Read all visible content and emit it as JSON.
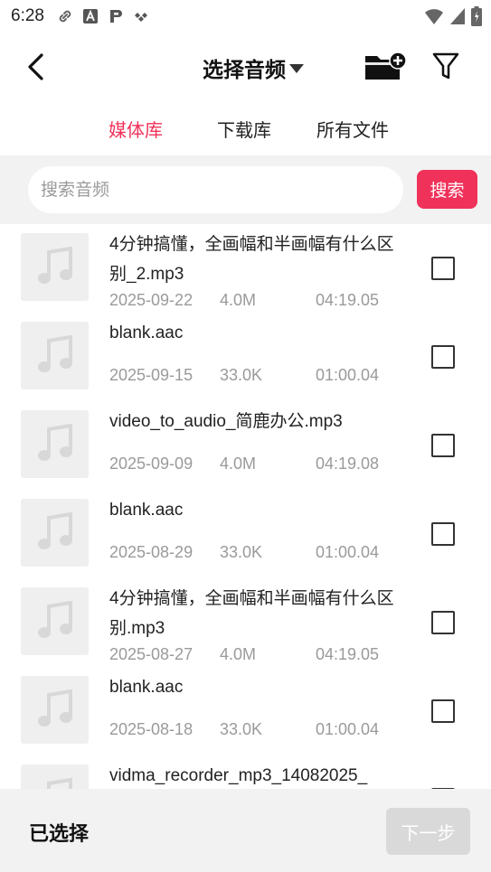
{
  "status_bar": {
    "time": "6:28",
    "left_icons": [
      "link-icon",
      "a-icon",
      "p-icon",
      "dots-icon"
    ],
    "right_icons": [
      "wifi-icon",
      "signal-icon",
      "battery-icon"
    ]
  },
  "header": {
    "title": "选择音频",
    "title_dropdown_icon": "caret-down-icon",
    "back_icon": "chevron-left-icon",
    "folder_icon": "folder-add-icon",
    "filter_icon": "filter-icon"
  },
  "tabs": [
    {
      "label": "媒体库",
      "active": true
    },
    {
      "label": "下载库",
      "active": false
    },
    {
      "label": "所有文件",
      "active": false
    }
  ],
  "search": {
    "placeholder": "搜索音频",
    "value": "",
    "button_label": "搜索"
  },
  "files": [
    {
      "name": "4分钟搞懂，全画幅和半画幅有什么区别_2.mp3",
      "date": "2025-09-22",
      "size": "4.0M",
      "duration": "04:19.05",
      "checked": false
    },
    {
      "name": "blank.aac",
      "date": "2025-09-15",
      "size": "33.0K",
      "duration": "01:00.04",
      "checked": false
    },
    {
      "name": "video_to_audio_简鹿办公.mp3",
      "date": "2025-09-09",
      "size": "4.0M",
      "duration": "04:19.08",
      "checked": false
    },
    {
      "name": "blank.aac",
      "date": "2025-08-29",
      "size": "33.0K",
      "duration": "01:00.04",
      "checked": false
    },
    {
      "name": "4分钟搞懂，全画幅和半画幅有什么区别.mp3",
      "date": "2025-08-27",
      "size": "4.0M",
      "duration": "04:19.05",
      "checked": false
    },
    {
      "name": "blank.aac",
      "date": "2025-08-18",
      "size": "33.0K",
      "duration": "01:00.04",
      "checked": false
    },
    {
      "name": "vidma_recorder_mp3_14082025_",
      "date": "",
      "size": "",
      "duration": "",
      "checked": false
    }
  ],
  "bottom": {
    "selected_label": "已选择",
    "next_label": "下一步"
  },
  "colors": {
    "accent": "#f0325a",
    "disabled": "#d9d9d9",
    "meta_text": "#9a9a9a",
    "panel_bg": "#f2f2f2"
  }
}
